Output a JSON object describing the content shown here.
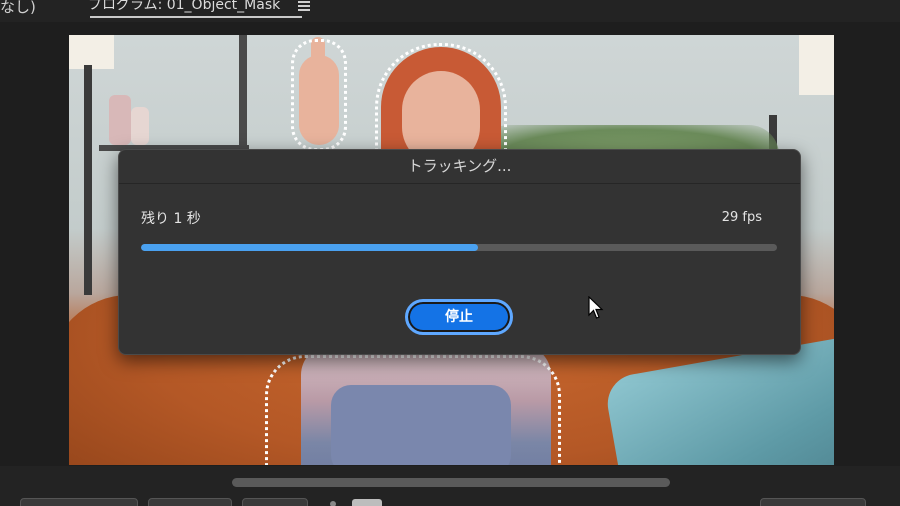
{
  "header": {
    "left_label": "なし)",
    "program_tab": "プログラム: 01_Object_Mask"
  },
  "dialog": {
    "title": "トラッキング...",
    "time_remaining": "残り 1 秒",
    "fps": "29 fps",
    "progress": 0.53,
    "stop_label": "停止"
  },
  "colors": {
    "accent": "#1473e6",
    "progress_fill": "#4aa1f0",
    "dialog_bg": "#333333",
    "app_bg": "#232323"
  },
  "icons": [
    "menu-icon",
    "mouse-cursor-icon"
  ]
}
